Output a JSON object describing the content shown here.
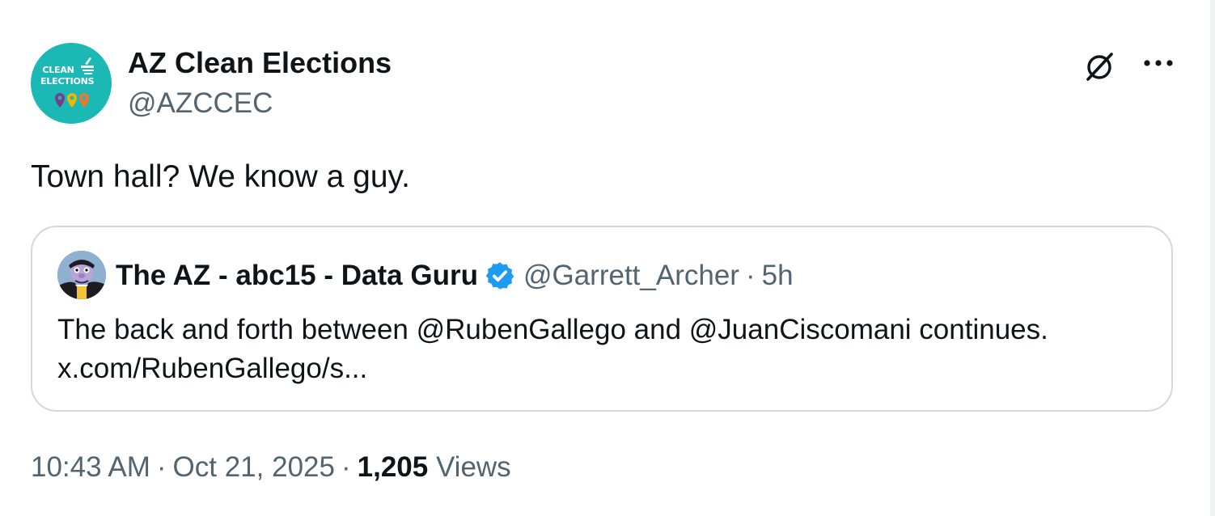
{
  "tweet": {
    "author": {
      "name": "AZ Clean Elections",
      "handle": "@AZCCEC",
      "avatar_text_line1": "CLEAN",
      "avatar_text_line2": "ELECTIONS",
      "avatar_color": "#1cb8b6"
    },
    "text": "Town hall? We know a guy.",
    "icons": {
      "grok": "grok-icon",
      "more": "more-options-icon"
    },
    "quote": {
      "author_name": "The AZ - abc15 - Data Guru",
      "verified": true,
      "handle": "@Garrett_Archer",
      "separator": "·",
      "time": "5h",
      "text_line1": "The back and forth between @RubenGallego and @JuanCiscomani continues.",
      "text_line2": "x.com/RubenGallego/s..."
    },
    "footer": {
      "time": "10:43 AM",
      "separator": "·",
      "date": "Oct 21, 2025",
      "views_count": "1,205",
      "views_label": "Views"
    }
  },
  "colors": {
    "primary_text": "#0f1419",
    "secondary_text": "#536471",
    "border": "#cfd9de",
    "verified_blue": "#1d9bf0"
  }
}
